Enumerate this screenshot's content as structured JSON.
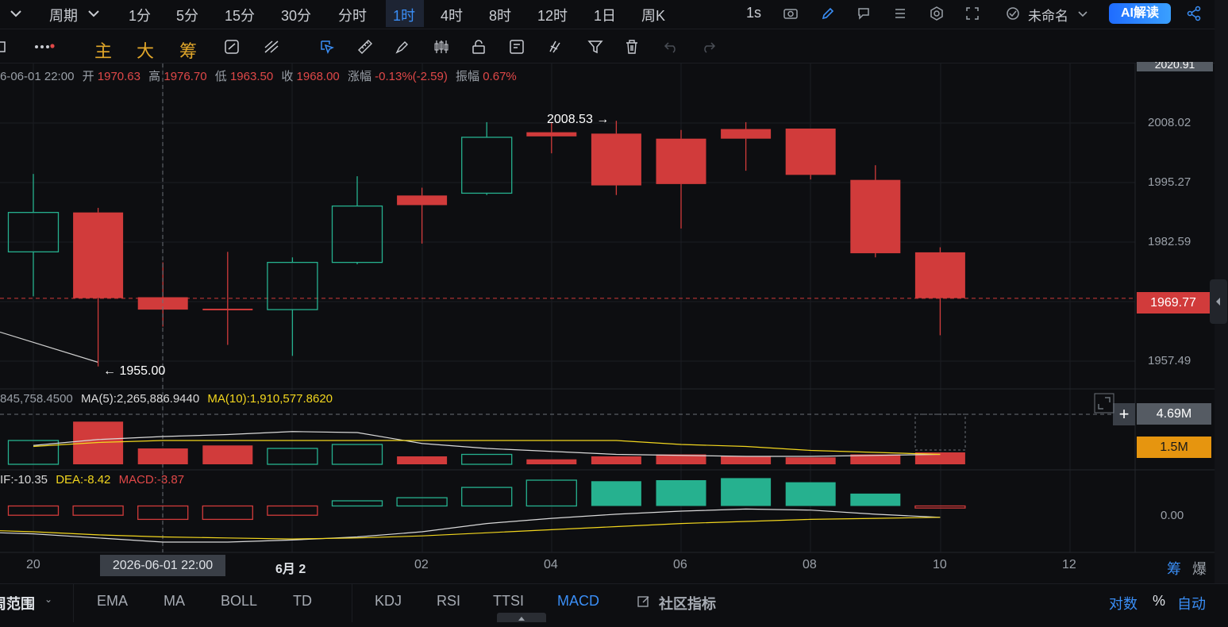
{
  "topbar": {
    "period": "周期",
    "intervals": [
      "1分",
      "5分",
      "15分",
      "30分",
      "分时",
      "1时",
      "4时",
      "8时",
      "12时",
      "1日",
      "周K"
    ],
    "active": "1时",
    "speed": "1s",
    "layout_name": "未命名",
    "ai_label": "AI解读"
  },
  "toolbar2": {
    "zhu": "主",
    "da": "大",
    "chou": "筹"
  },
  "ohlc": {
    "date": "6-06-01 22:00",
    "open_label": "开",
    "open": "1970.63",
    "high_label": "高",
    "high": "1976.70",
    "low_label": "低",
    "low": "1963.50",
    "close_label": "收",
    "close": "1968.00",
    "chg_label": "涨幅",
    "chg": "-0.13%(-2.59)",
    "amp_label": "振幅",
    "amp": "0.67%"
  },
  "vol_legend": {
    "vol": "845,758.4500",
    "ma5": "MA(5):2,265,886.9440",
    "ma10": "MA(10):1,910,577.8620"
  },
  "macd_legend": {
    "dif": "IF:-10.35",
    "dea": "DEA:-8.42",
    "macd": "MACD:-3.87"
  },
  "price_axis": [
    "2008.02",
    "1995.27",
    "1982.59",
    "1957.49"
  ],
  "top_price": "2020.91",
  "current_price": "1969.77",
  "vol_axis": {
    "upper": "4.69M",
    "lower": "1.5M"
  },
  "macd_axis": "0.00",
  "x_axis": [
    "20",
    "6月 2",
    "02",
    "04",
    "06",
    "08",
    "10",
    "12"
  ],
  "crosshair_time": "2026-06-01 22:00",
  "annotations": {
    "high": "2008.53",
    "low": "1955.00",
    "high_arrow": "→",
    "low_arrow": "←"
  },
  "axis_corner": {
    "chou": "筹",
    "bao": "爆"
  },
  "bottombar": {
    "range": "周范围",
    "main_ind": [
      "EMA",
      "MA",
      "BOLL",
      "TD"
    ],
    "sub_ind": [
      "KDJ",
      "RSI",
      "TTSI",
      "MACD"
    ],
    "active": "MACD",
    "community": "社区指标",
    "log": "对数",
    "pct": "%",
    "auto": "自动"
  },
  "colors": {
    "up": "#26b18f",
    "down": "#d13b3b",
    "ma5": "#d9d9d9",
    "ma10": "#f2d61e",
    "accent": "#3a8ef6"
  },
  "chart_data": {
    "type": "candlestick",
    "candles": [
      {
        "open": 1979.9,
        "close": 1988.5,
        "high": 1996.9,
        "low": 1970.2
      },
      {
        "open": 1988.5,
        "close": 1969.8,
        "high": 1989.5,
        "low": 1954.9
      },
      {
        "open": 1970.0,
        "close": 1967.3,
        "high": 1977.6,
        "low": 1963.6
      },
      {
        "open": 1967.5,
        "close": 1967.2,
        "high": 1979.9,
        "low": 1959.6
      },
      {
        "open": 1967.3,
        "close": 1977.6,
        "high": 1978.7,
        "low": 1957.2
      },
      {
        "open": 1977.6,
        "close": 1989.9,
        "high": 1996.4,
        "low": 1977.2
      },
      {
        "open": 1992.2,
        "close": 1990.1,
        "high": 1993.9,
        "low": 1981.7
      },
      {
        "open": 1992.7,
        "close": 2004.9,
        "high": 2008.2,
        "low": 1992.3
      },
      {
        "open": 2006.0,
        "close": 2005.1,
        "high": 2008.2,
        "low": 2001.4
      },
      {
        "open": 2005.7,
        "close": 1994.4,
        "high": 2008.5,
        "low": 1992.3
      },
      {
        "open": 2004.6,
        "close": 1994.7,
        "high": 2006.5,
        "low": 1985.0
      },
      {
        "open": 2006.7,
        "close": 2004.6,
        "high": 2008.2,
        "low": 1997.6
      },
      {
        "open": 2006.8,
        "close": 1996.7,
        "high": 2006.8,
        "low": 1995.7
      },
      {
        "open": 1995.6,
        "close": 1979.6,
        "high": 1998.8,
        "low": 1978.7
      },
      {
        "open": 1979.8,
        "close": 1969.8,
        "high": 1980.9,
        "low": 1961.7
      }
    ],
    "volume": {
      "values": [
        2.4,
        4.3,
        1.6,
        1.9,
        1.6,
        2.0,
        0.8,
        1.0,
        0.5,
        0.8,
        1.0,
        0.8,
        0.7,
        1.0,
        1.2
      ],
      "ma5": [
        1.9,
        2.5,
        2.8,
        3.0,
        3.3,
        3.2,
        2.1,
        1.6,
        1.3,
        1.0,
        0.9,
        0.8,
        0.8,
        0.9,
        1.0
      ],
      "ma10": [
        1.8,
        2.2,
        2.4,
        2.4,
        2.4,
        2.4,
        2.4,
        2.4,
        2.4,
        2.4,
        2.0,
        1.8,
        1.4,
        1.2,
        1.0
      ],
      "unit": "M"
    },
    "macd": {
      "hist": [
        -0.9,
        -0.9,
        -1.3,
        -1.3,
        -0.9,
        0.5,
        0.8,
        1.8,
        2.5,
        2.4,
        2.5,
        2.7,
        2.3,
        1.2,
        -0.2
      ],
      "dif": [
        -2.7,
        -3.1,
        -3.5,
        -3.5,
        -3.3,
        -3.0,
        -2.5,
        -1.7,
        -1.2,
        -0.8,
        -0.5,
        -0.3,
        -0.4,
        -0.8,
        -1.1
      ],
      "dea": [
        -2.5,
        -2.8,
        -3.0,
        -3.1,
        -3.2,
        -3.1,
        -2.9,
        -2.6,
        -2.3,
        -2.0,
        -1.7,
        -1.5,
        -1.3,
        -1.2,
        -1.1
      ]
    },
    "ylim_price": [
      1950,
      2021
    ],
    "ylim_vol": [
      0,
      5.2
    ],
    "ylim_macd": [
      -4.5,
      3.5
    ]
  }
}
